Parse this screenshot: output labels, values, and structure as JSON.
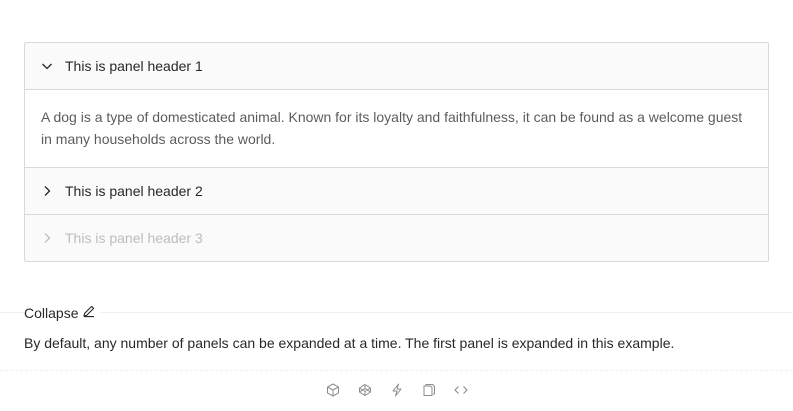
{
  "collapse": {
    "panels": [
      {
        "header": "This is panel header 1",
        "expanded": true,
        "disabled": false,
        "content": "A dog is a type of domesticated animal. Known for its loyalty and faithfulness, it can be found as a welcome guest in many households across the world."
      },
      {
        "header": "This is panel header 2",
        "expanded": false,
        "disabled": false
      },
      {
        "header": "This is panel header 3",
        "expanded": false,
        "disabled": true
      }
    ]
  },
  "demo": {
    "title": "Collapse",
    "title_icon": "edit-icon",
    "description": "By default, any number of panels can be expanded at a time. The first panel is expanded in this example."
  },
  "actions": [
    "codesandbox-icon",
    "codepen-icon",
    "riddle-icon",
    "copy-icon",
    "code-icon"
  ],
  "colors": {
    "border": "#d9d9d9",
    "header_bg": "#fafafa",
    "text": "#262626",
    "content_text": "#595959",
    "disabled_text": "#bfbfbf",
    "icon_gray": "#8c8c8c"
  }
}
